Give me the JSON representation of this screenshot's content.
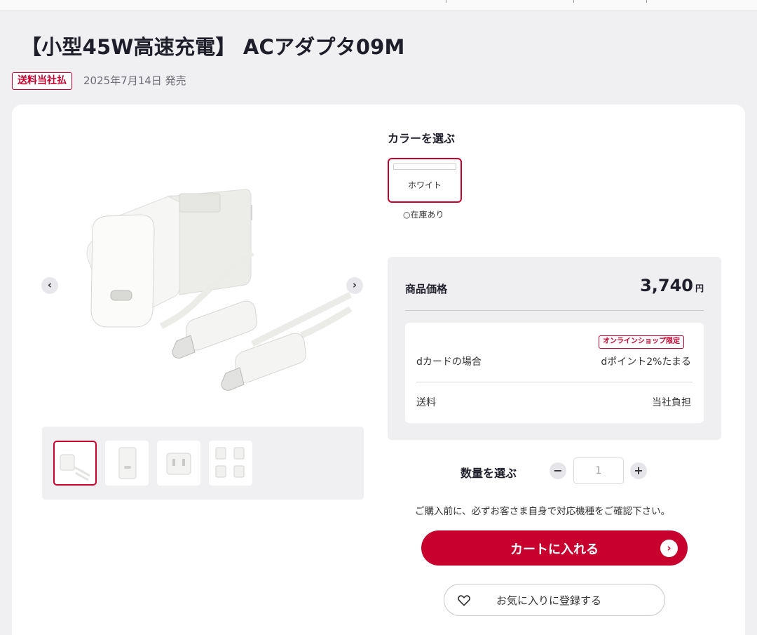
{
  "product": {
    "title": "【小型45W高速充電】 ACアダプタ09M",
    "shipping_badge": "送料当社払",
    "release_date": "2025年7月14日 発売"
  },
  "gallery": {
    "thumbnails": [
      "thumbnail-1",
      "thumbnail-2",
      "thumbnail-3",
      "thumbnail-4"
    ],
    "selected_index": 0
  },
  "color": {
    "heading": "カラーを選ぶ",
    "options": [
      {
        "name": "ホワイト",
        "swatch": "#ffffff",
        "stock": "○在庫あり"
      }
    ]
  },
  "price": {
    "label": "商品価格",
    "value": "3,740",
    "unit": "円",
    "limited_badge": "オンラインショップ限定",
    "dcard_label": "dカードの場合",
    "dcard_value": "dポイント2%たまる",
    "shipping_label": "送料",
    "shipping_value": "当社負担"
  },
  "quantity": {
    "label": "数量を選ぶ",
    "value": "1",
    "minus": "−",
    "plus": "+"
  },
  "notice": "ご購入前に、必ずお客さま自身で対応機種をご確認下さい。",
  "buttons": {
    "cart": "カートに入れる",
    "favorite": "お気に入りに登録する"
  },
  "colors": {
    "accent": "#c8002e",
    "background": "#f0f0f3"
  },
  "icons": {
    "prev": "chevron-left-icon",
    "next": "chevron-right-icon",
    "cart_arrow": "chevron-right-icon",
    "heart": "heart-icon"
  }
}
